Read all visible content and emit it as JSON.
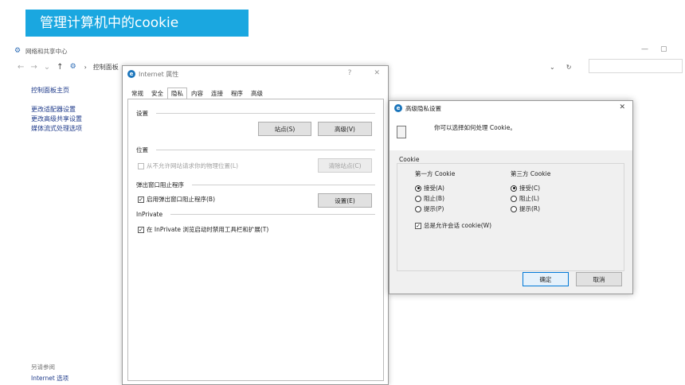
{
  "banner": {
    "title": "管理计算机中的cookie"
  },
  "window": {
    "title": "网络和共享中心",
    "min_glyph": "—",
    "max_glyph": "▢",
    "nav": {
      "back": "←",
      "forward": "→",
      "recent": "⌄",
      "up": "↑"
    },
    "breadcrumb": {
      "root": "控制面板",
      "sep": "›"
    },
    "dropdown_glyph": "⌄",
    "refresh_glyph": "↻"
  },
  "left_nav": {
    "home": "控制面板主页",
    "items": [
      "更改适配器设置",
      "更改高级共享设置",
      "媒体流式处理选项"
    ],
    "see_also_title": "另请参阅",
    "see_also_link": "Internet 选项"
  },
  "internet_properties": {
    "title": "Internet 属性",
    "help_glyph": "?",
    "close_glyph": "✕",
    "tabs": [
      "常规",
      "安全",
      "隐私",
      "内容",
      "连接",
      "程序",
      "高级"
    ],
    "active_tab": "隐私",
    "settings_label": "设置",
    "sites_button": "站点(S)",
    "advanced_button": "高级(V)",
    "location_label": "位置",
    "location_checkbox": "从不允许网站请求你的物理位置(L)",
    "clear_sites_button": "清除站点(C)",
    "popup_label": "弹出窗口阻止程序",
    "popup_checkbox": "启用弹出窗口阻止程序(B)",
    "popup_settings_button": "设置(E)",
    "inprivate_label": "InPrivate",
    "inprivate_checkbox": "在 InPrivate 浏览启动时禁用工具栏和扩展(T)",
    "check_glyph": "✓"
  },
  "advanced_privacy": {
    "title": "高级隐私设置",
    "close_glyph": "✕",
    "info": "你可以选择如何处理 Cookie。",
    "cookie_label": "Cookie",
    "first_party_head": "第一方 Cookie",
    "third_party_head": "第三方 Cookie",
    "first_party_options": [
      "接受(A)",
      "阻止(B)",
      "提示(P)"
    ],
    "third_party_options": [
      "接受(C)",
      "阻止(L)",
      "提示(R)"
    ],
    "first_party_selected": 0,
    "third_party_selected": 0,
    "session_checkbox": "总是允许会话 cookie(W)",
    "ok_button": "确定",
    "cancel_button": "取消"
  },
  "colors": {
    "banner": "#1aa7e0",
    "link": "#1e3a8a",
    "ok_border": "#0078d7"
  }
}
